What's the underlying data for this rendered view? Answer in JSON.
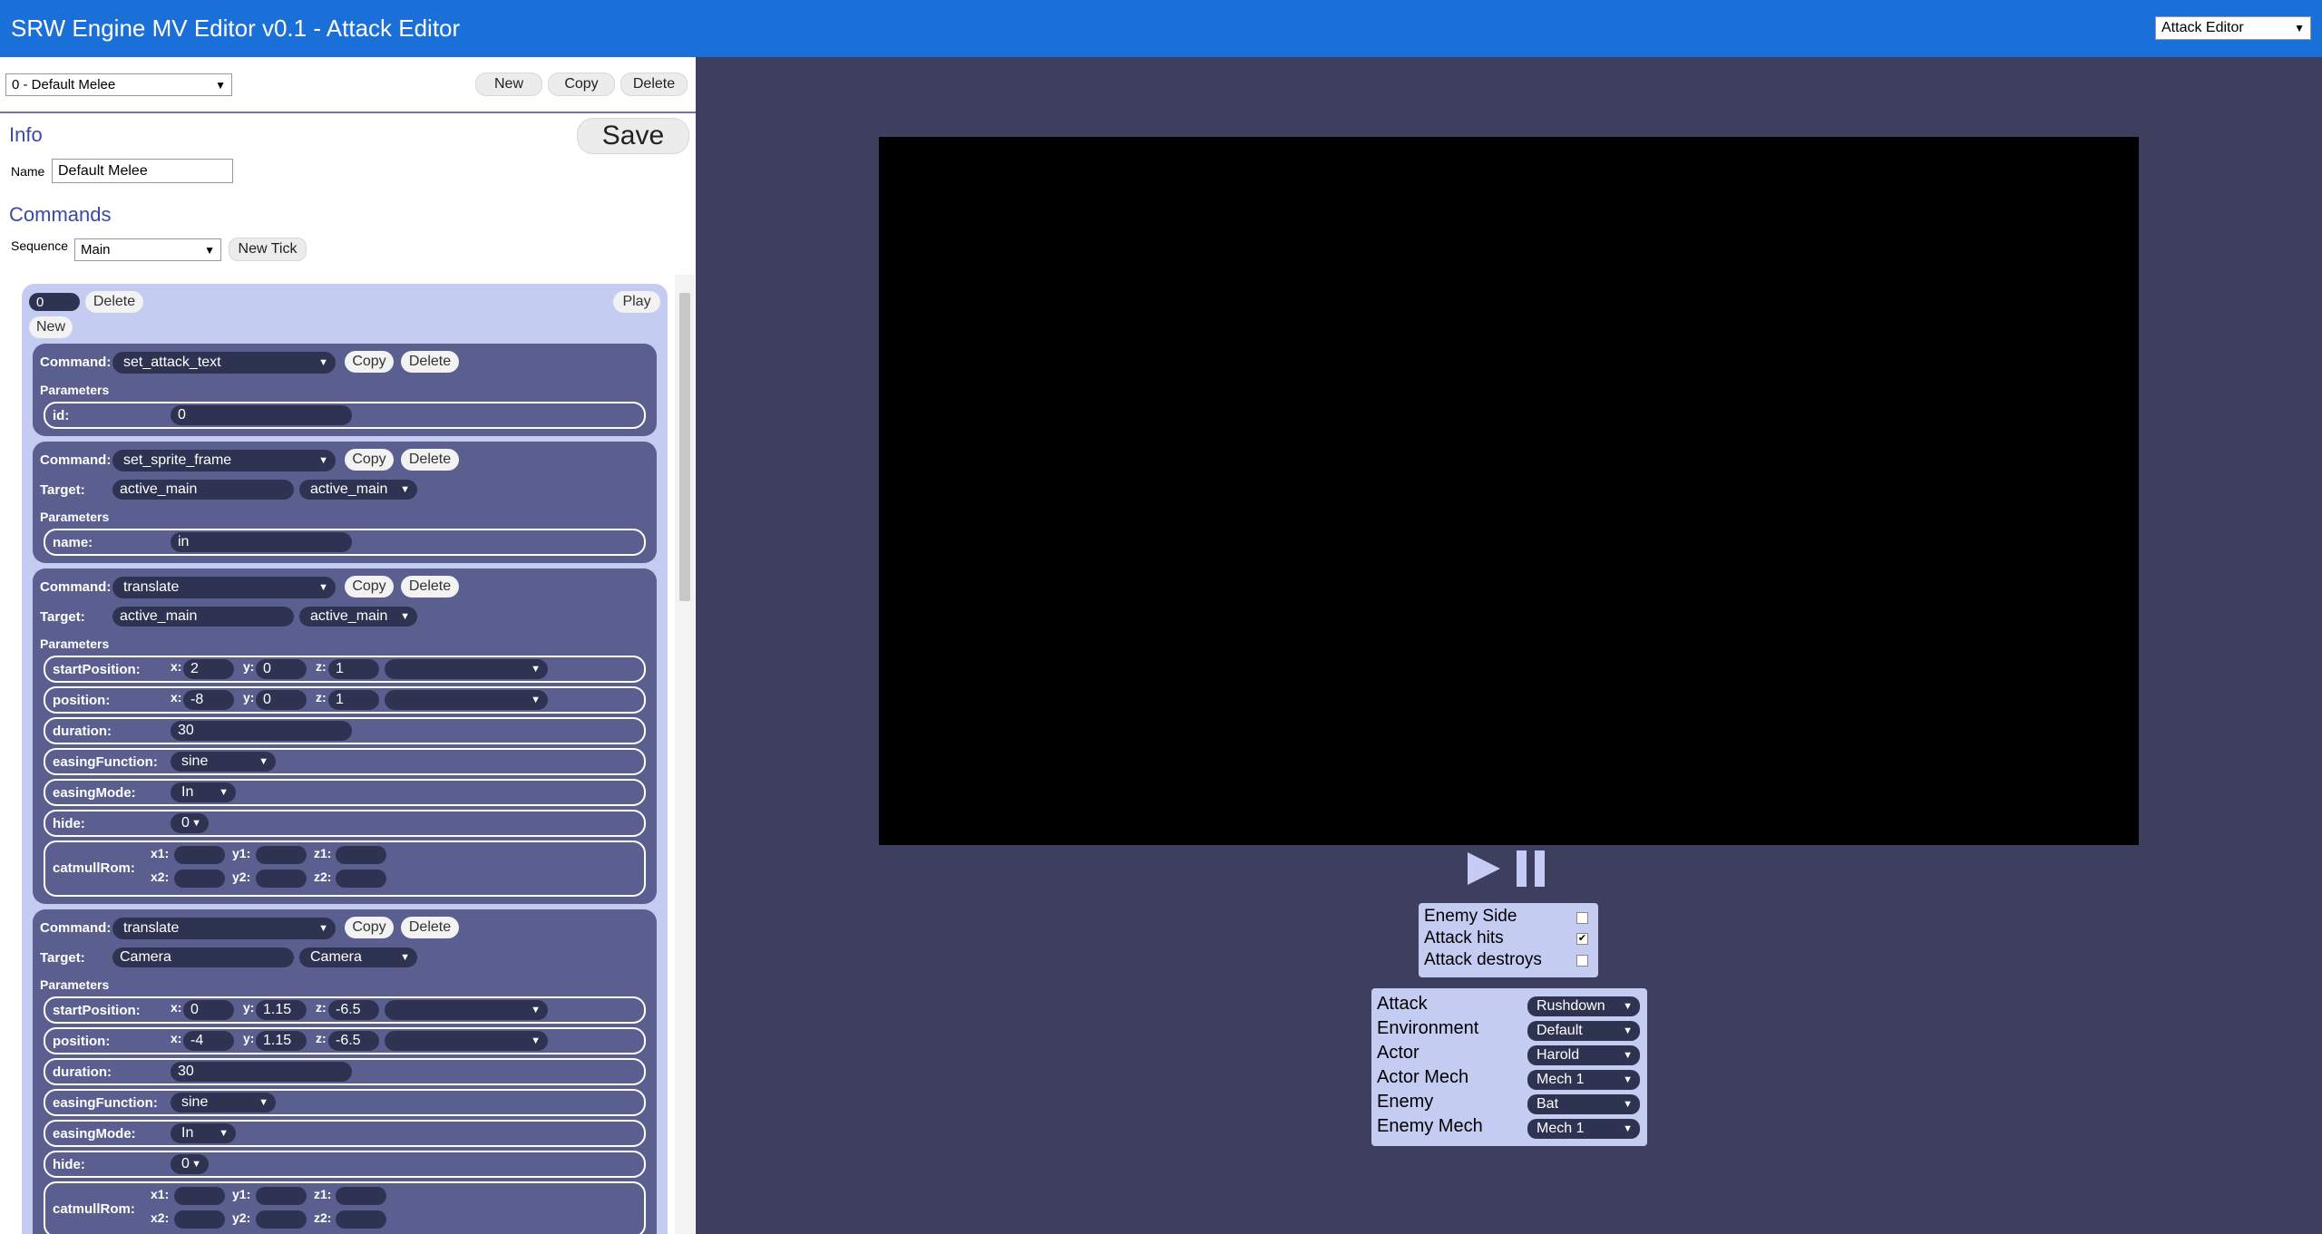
{
  "header": {
    "title": "SRW Engine MV Editor v0.1 - Attack Editor",
    "mode_select": "Attack Editor"
  },
  "toolbar": {
    "attack_select": "0 - Default Melee",
    "new_label": "New",
    "copy_label": "Copy",
    "delete_label": "Delete"
  },
  "info": {
    "heading": "Info",
    "save_label": "Save",
    "name_label": "Name",
    "name_value": "Default Melee"
  },
  "commands": {
    "heading": "Commands",
    "sequence_label": "Sequence",
    "sequence_value": "Main",
    "new_tick_label": "New Tick"
  },
  "tick": {
    "value": "0",
    "delete_label": "Delete",
    "play_label": "Play",
    "new_label": "New"
  },
  "labels": {
    "command": "Command:",
    "target": "Target:",
    "parameters": "Parameters",
    "copy": "Copy",
    "delete": "Delete",
    "x": "x:",
    "y": "y:",
    "z": "z:",
    "x1": "x1:",
    "y1": "y1:",
    "z1": "z1:",
    "x2": "x2:",
    "y2": "y2:",
    "z2": "z2:"
  },
  "cards": [
    {
      "command": "set_attack_text",
      "params": [
        {
          "name": "id:",
          "value": "0"
        }
      ]
    },
    {
      "command": "set_sprite_frame",
      "target_text": "active_main",
      "target_select": "active_main",
      "params": [
        {
          "name": "name:",
          "value": "in"
        }
      ]
    },
    {
      "command": "translate",
      "target_text": "active_main",
      "target_select": "active_main",
      "params": {
        "startPosition": {
          "label": "startPosition:",
          "x": "2",
          "y": "0",
          "z": "1"
        },
        "position": {
          "label": "position:",
          "x": "-8",
          "y": "0",
          "z": "1"
        },
        "duration": {
          "label": "duration:",
          "value": "30"
        },
        "easingFunction": {
          "label": "easingFunction:",
          "value": "sine"
        },
        "easingMode": {
          "label": "easingMode:",
          "value": "In"
        },
        "hide": {
          "label": "hide:",
          "value": "0"
        },
        "catmullRom": {
          "label": "catmullRom:"
        }
      }
    },
    {
      "command": "translate",
      "target_text": "Camera",
      "target_select": "Camera",
      "params": {
        "startPosition": {
          "label": "startPosition:",
          "x": "0",
          "y": "1.15",
          "z": "-6.5"
        },
        "position": {
          "label": "position:",
          "x": "-4",
          "y": "1.15",
          "z": "-6.5"
        },
        "duration": {
          "label": "duration:",
          "value": "30"
        },
        "easingFunction": {
          "label": "easingFunction:",
          "value": "sine"
        },
        "easingMode": {
          "label": "easingMode:",
          "value": "In"
        },
        "hide": {
          "label": "hide:",
          "value": "0"
        },
        "catmullRom": {
          "label": "catmullRom:"
        }
      }
    }
  ],
  "preview": {
    "flags": [
      {
        "label": "Enemy Side",
        "checked": false
      },
      {
        "label": "Attack hits",
        "checked": true
      },
      {
        "label": "Attack destroys",
        "checked": false
      }
    ],
    "settings": [
      {
        "label": "Attack",
        "value": "Rushdown"
      },
      {
        "label": "Environment",
        "value": "Default"
      },
      {
        "label": "Actor",
        "value": "Harold"
      },
      {
        "label": "Actor Mech",
        "value": "Mech 1"
      },
      {
        "label": "Enemy",
        "value": "Bat"
      },
      {
        "label": "Enemy Mech",
        "value": "Mech 1"
      }
    ]
  }
}
